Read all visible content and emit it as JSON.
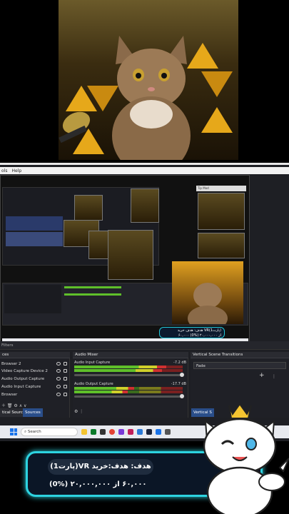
{
  "menubar": {
    "items": [
      "ols",
      "Help"
    ]
  },
  "mini": {
    "window_label": "Tip Mod"
  },
  "nested_banner": {
    "line1": "هدف: هدف خرید VR(پارت1)",
    "line2": "۶۰,۰۰۰ از ۲۰,۰۰۰,۰۰۰ (%0)"
  },
  "filters_bar": {
    "label": "Filters"
  },
  "sources": {
    "title": "ces",
    "items": [
      "Browser 2",
      "Video Capture Device 2",
      "Audio Output Capture",
      "Audio Input Capture",
      "Browser"
    ]
  },
  "mixer": {
    "title": "Audio Mixer",
    "tracks": [
      {
        "name": "Audio Input Capture",
        "db": "-7.2 dB",
        "level": 0.85
      },
      {
        "name": "Audio Output Capture",
        "db": "-17.7 dB",
        "level": 0.55
      }
    ]
  },
  "transitions": {
    "title": "Vertical Scene Transitions",
    "selected": "Fade"
  },
  "tabs": {
    "scenes": "tical Sources",
    "sources": "Sources",
    "vertical": "Vertical S"
  },
  "taskbar": {
    "search_placeholder": "Search"
  },
  "overlay": {
    "goal_label": "هدف: هدف:خرید VR(پارت1)",
    "progress": "۶۰,۰۰۰ از ۲۰,۰۰۰,۰۰۰ (%0)"
  },
  "colors": {
    "accent": "#2dd3e0",
    "obs_bg": "#1e1f24",
    "meter_green": "#5fbf2a"
  }
}
